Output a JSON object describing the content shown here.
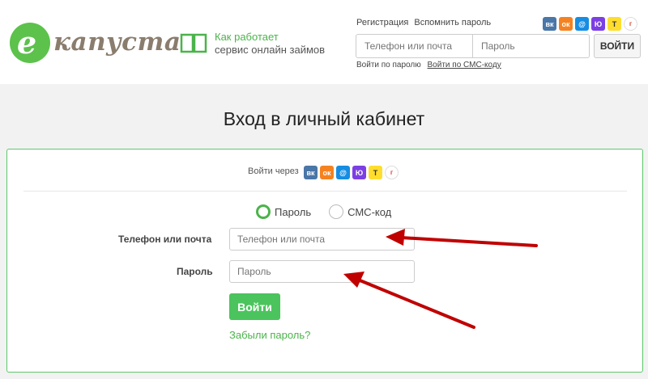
{
  "brand": {
    "logo_letter": "е",
    "logo_text": "капуста"
  },
  "how_it_works": {
    "line1": "Как работает",
    "line2": "сервис онлайн займов"
  },
  "header": {
    "register_link": "Регистрация",
    "remember_link": "Вспомнить пароль",
    "phone_placeholder": "Телефон или почта",
    "password_placeholder": "Пароль",
    "login_button": "ВОЙТИ",
    "login_by_password": "Войти по паролю",
    "login_by_sms": "Войти по СМС-коду"
  },
  "social": [
    {
      "name": "vk",
      "glyph": "вк"
    },
    {
      "name": "ok",
      "glyph": "ок"
    },
    {
      "name": "mail",
      "glyph": "@"
    },
    {
      "name": "yu",
      "glyph": "Ю"
    },
    {
      "name": "t",
      "glyph": "Т"
    },
    {
      "name": "gosuslugi",
      "glyph": "г"
    }
  ],
  "page_title": "Вход в личный кабинет",
  "card": {
    "login_via": "Войти через",
    "radio_password": "Пароль",
    "radio_sms": "СМС-код",
    "phone_label": "Телефон или почта",
    "phone_placeholder": "Телефон или почта",
    "password_label": "Пароль",
    "password_placeholder": "Пароль",
    "login_button": "Войти",
    "forgot_link": "Забыли пароль?"
  },
  "colors": {
    "brand_green": "#4bb34b",
    "button_green": "#4bc45d",
    "arrow_red": "#c00000"
  }
}
